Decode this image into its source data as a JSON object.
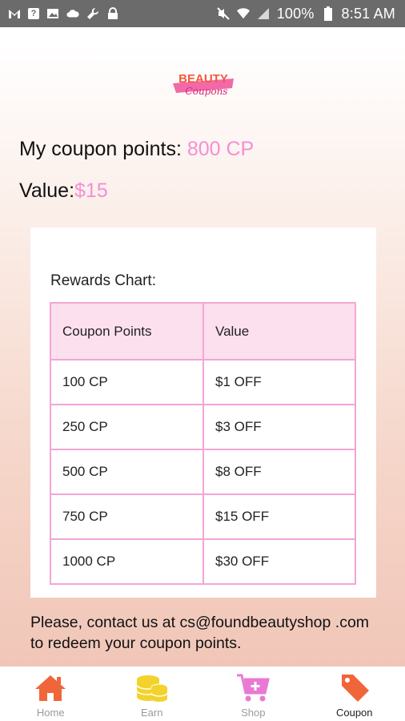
{
  "status_bar": {
    "battery_text": "100%",
    "time": "8:51 AM"
  },
  "logo": {
    "text_top": "BEAUTY",
    "text_bottom": "Coupons"
  },
  "points": {
    "label": "My coupon points: ",
    "value": "800 CP"
  },
  "value": {
    "label": "Value:",
    "amount": "$15"
  },
  "rewards": {
    "title": "Rewards Chart:",
    "headers": [
      "Coupon Points",
      "Value"
    ],
    "rows": [
      [
        "100 CP",
        "$1 OFF"
      ],
      [
        "250 CP",
        "$3 OFF"
      ],
      [
        "500 CP",
        "$8 OFF"
      ],
      [
        "750 CP",
        "$15 OFF"
      ],
      [
        "1000 CP",
        "$30 OFF"
      ]
    ]
  },
  "contact": {
    "text": "Please, contact us at cs@foundbeautyshop .com to redeem your coupon points."
  },
  "nav": {
    "items": [
      {
        "label": "Home",
        "icon": "home-icon",
        "color": "#f0663a"
      },
      {
        "label": "Earn",
        "icon": "coins-icon",
        "color": "#f3d22b"
      },
      {
        "label": "Shop",
        "icon": "cart-icon",
        "color": "#e979d4"
      },
      {
        "label": "Coupon",
        "icon": "tag-icon",
        "color": "#f0663a"
      }
    ],
    "active": "Coupon"
  },
  "colors": {
    "accent_pink": "#f48fd6",
    "table_border": "#f3a6d6",
    "table_header_bg": "#fde0ee"
  }
}
